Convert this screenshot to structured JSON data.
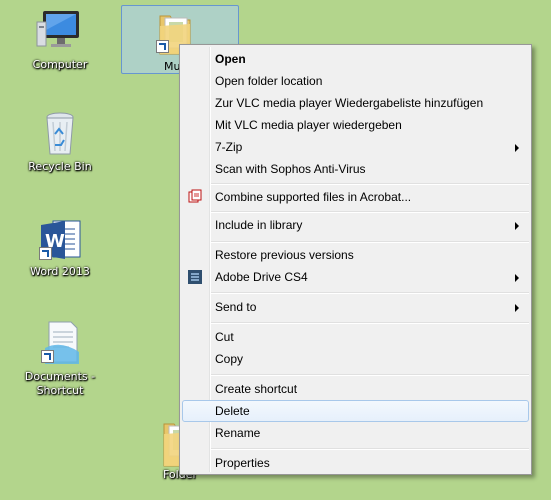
{
  "desktop": {
    "icons": [
      {
        "label": "Computer"
      },
      {
        "label": "Recycle Bin"
      },
      {
        "label": "Word 2013"
      },
      {
        "label": "Documents -\nShortcut"
      },
      {
        "label": "Folder"
      }
    ],
    "selected_label": "Mu"
  },
  "menu": {
    "items": [
      {
        "label": "Open"
      },
      {
        "label": "Open folder location"
      },
      {
        "label": "Zur VLC media player Wiedergabeliste hinzufügen"
      },
      {
        "label": "Mit VLC media player wiedergeben"
      },
      {
        "label": "7-Zip"
      },
      {
        "label": "Scan with Sophos Anti-Virus"
      },
      {
        "label": "Combine supported files in Acrobat..."
      },
      {
        "label": "Include in library"
      },
      {
        "label": "Restore previous versions"
      },
      {
        "label": "Adobe Drive CS4"
      },
      {
        "label": "Send to"
      },
      {
        "label": "Cut"
      },
      {
        "label": "Copy"
      },
      {
        "label": "Create shortcut"
      },
      {
        "label": "Delete"
      },
      {
        "label": "Rename"
      },
      {
        "label": "Properties"
      }
    ],
    "hovered": "Delete"
  },
  "colors": {
    "desktop_bg": "#b3d58c",
    "menu_bg": "#f0f0f0",
    "hover_border": "#a8c8ea"
  }
}
